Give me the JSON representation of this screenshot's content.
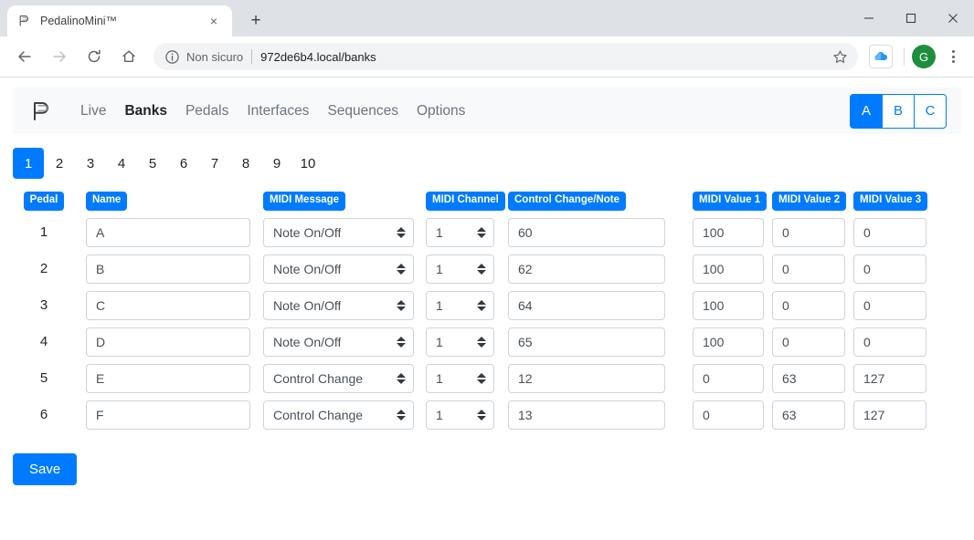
{
  "browser": {
    "tab": {
      "title": "PedalinoMini™",
      "favicon_name": "pedalino-favicon",
      "close_label": "×"
    },
    "new_tab_label": "+",
    "window_controls": {
      "minimize": "−",
      "maximize": "□",
      "close": "✕"
    },
    "toolbar": {
      "back": "←",
      "forward": "→",
      "reload": "↻",
      "home": "⌂",
      "security_text": "Non sicuro",
      "url": "972de6b4.local/banks",
      "star": "☆",
      "avatar_letter": "G"
    }
  },
  "app": {
    "brand_name": "pedalino-logo",
    "nav_items": [
      {
        "label": "Live",
        "active": false
      },
      {
        "label": "Banks",
        "active": true
      },
      {
        "label": "Pedals",
        "active": false
      },
      {
        "label": "Interfaces",
        "active": false
      },
      {
        "label": "Sequences",
        "active": false
      },
      {
        "label": "Options",
        "active": false
      }
    ],
    "abc_buttons": [
      {
        "label": "A",
        "active": true
      },
      {
        "label": "B",
        "active": false
      },
      {
        "label": "C",
        "active": false
      }
    ],
    "banks": [
      {
        "label": "1",
        "active": true
      },
      {
        "label": "2",
        "active": false
      },
      {
        "label": "3",
        "active": false
      },
      {
        "label": "4",
        "active": false
      },
      {
        "label": "5",
        "active": false
      },
      {
        "label": "6",
        "active": false
      },
      {
        "label": "7",
        "active": false
      },
      {
        "label": "8",
        "active": false
      },
      {
        "label": "9",
        "active": false
      },
      {
        "label": "10",
        "active": false
      }
    ],
    "headers": {
      "pedal": "Pedal",
      "name": "Name",
      "midi_message": "MIDI Message",
      "midi_channel": "MIDI Channel",
      "control_change_note": "Control Change/Note",
      "midi_value_1": "MIDI Value 1",
      "midi_value_2": "MIDI Value 2",
      "midi_value_3": "MIDI Value 3"
    },
    "rows": [
      {
        "pedal": "1",
        "name": "A",
        "message": "Note On/Off",
        "channel": "1",
        "cc_note": "60",
        "v1": "100",
        "v2": "0",
        "v3": "0"
      },
      {
        "pedal": "2",
        "name": "B",
        "message": "Note On/Off",
        "channel": "1",
        "cc_note": "62",
        "v1": "100",
        "v2": "0",
        "v3": "0"
      },
      {
        "pedal": "3",
        "name": "C",
        "message": "Note On/Off",
        "channel": "1",
        "cc_note": "64",
        "v1": "100",
        "v2": "0",
        "v3": "0"
      },
      {
        "pedal": "4",
        "name": "D",
        "message": "Note On/Off",
        "channel": "1",
        "cc_note": "65",
        "v1": "100",
        "v2": "0",
        "v3": "0"
      },
      {
        "pedal": "5",
        "name": "E",
        "message": "Control Change",
        "channel": "1",
        "cc_note": "12",
        "v1": "0",
        "v2": "63",
        "v3": "127"
      },
      {
        "pedal": "6",
        "name": "F",
        "message": "Control Change",
        "channel": "1",
        "cc_note": "13",
        "v1": "0",
        "v2": "63",
        "v3": "127"
      }
    ],
    "save_label": "Save",
    "colors": {
      "primary": "#007bff",
      "navbar_bg": "#f8f9fa",
      "border": "#ced4da",
      "text": "#495057"
    }
  }
}
